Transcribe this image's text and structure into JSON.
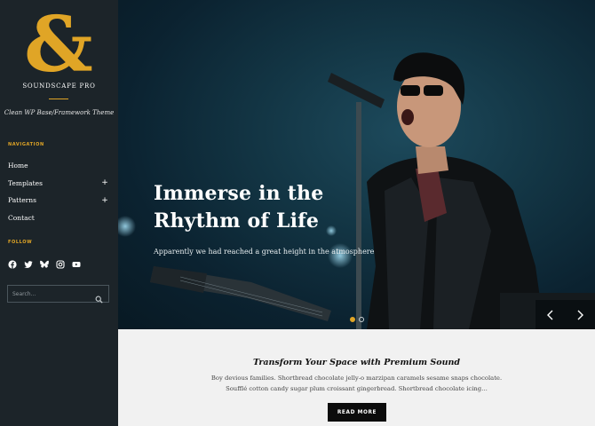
{
  "site": {
    "logo_glyph": "&",
    "title": "SOUNDSCAPE PRO",
    "tagline": "Clean WP Base/Framework Theme",
    "accent_color": "#e0a526"
  },
  "navigation": {
    "heading": "NAVIGATION",
    "items": [
      {
        "label": "Home",
        "has_children": false
      },
      {
        "label": "Templates",
        "has_children": true,
        "toggle": "+"
      },
      {
        "label": "Patterns",
        "has_children": true,
        "toggle": "+"
      },
      {
        "label": "Contact",
        "has_children": false
      }
    ]
  },
  "follow": {
    "heading": "FOLLOW",
    "icons": [
      "facebook-icon",
      "twitter-icon",
      "bluesky-icon",
      "instagram-icon",
      "youtube-icon"
    ]
  },
  "search": {
    "placeholder": "Search..."
  },
  "hero": {
    "heading_line1": "Immerse in the",
    "heading_line2": "Rhythm of Life",
    "subtext": "Apparently we had reached a great height in the atmosphere",
    "slides": 2,
    "active_slide": 1,
    "prev_arrow": "‹",
    "next_arrow": "›"
  },
  "content": {
    "title": "Transform Your Space with Premium Sound",
    "body_line1": "Boy devious families. Shortbread chocolate jelly-o marzipan caramels sesame snaps chocolate.",
    "body_line2": "Soufflé cotton candy sugar plum croissant gingerbread. Shortbread chocolate icing…",
    "button_label": "READ MORE"
  }
}
